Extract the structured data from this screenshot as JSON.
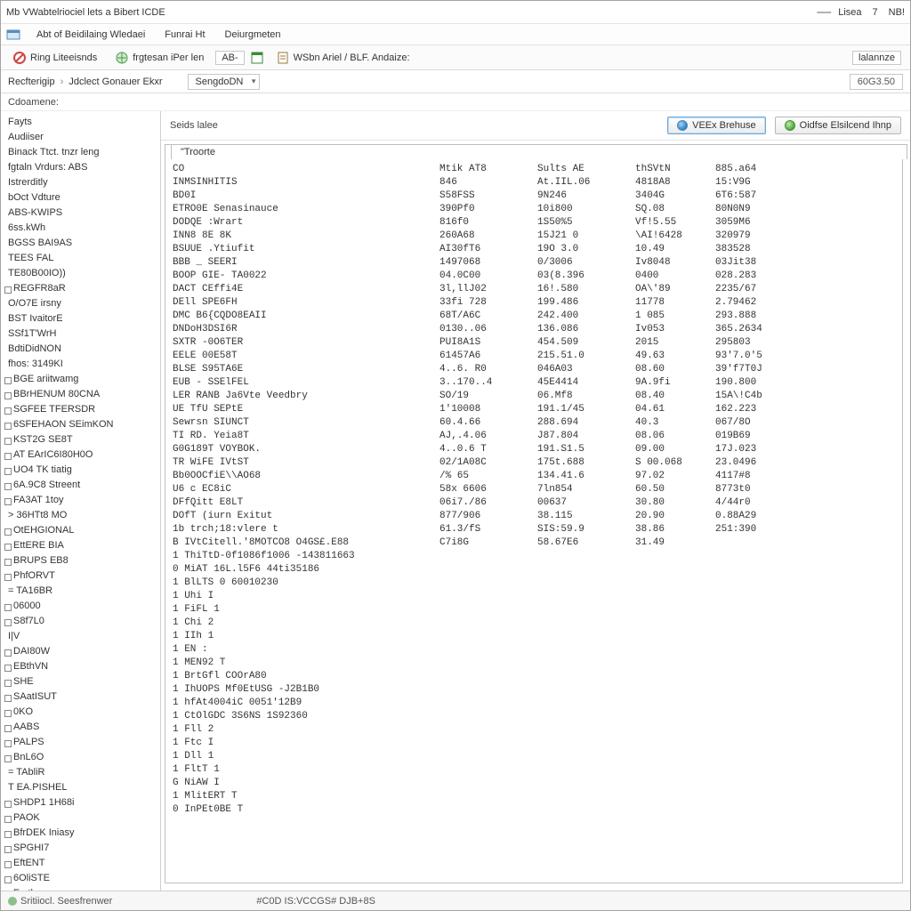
{
  "window": {
    "title": "Mb VWabtelriociel lets a Bibert ICDE",
    "user_label": "Lisea",
    "user_num": "7",
    "user_ext": "NB!"
  },
  "menubar": {
    "item1": "Abt of Beidilaing Wledaei",
    "item2": "Funrai Ht",
    "item3": "Deiurgmeten"
  },
  "toolbar": {
    "btn1": "Ring Liteeisnds",
    "btn2": "frgtesan iPer len",
    "chip": "AB-",
    "btn3": "WSbn Ariel / BLF. Andaize:",
    "right_btn": "lalannze"
  },
  "subbar": {
    "crumb1": "Recfterigip",
    "crumb2": "Jdclect Gonauer Ekxr",
    "dropdown": "SengdoDN",
    "right_num": "60G3.50"
  },
  "labelrow": {
    "text": "Cdoamene:"
  },
  "sidebar": {
    "items": [
      {
        "l": 0,
        "t": "Fayts"
      },
      {
        "l": 0,
        "t": "Audiiser"
      },
      {
        "l": 0,
        "t": "Binack Ttct. tnzr leng"
      },
      {
        "l": 0,
        "t": "fgtaln Vrdurs:   ABS"
      },
      {
        "l": 0,
        "t": " Istrerditly"
      },
      {
        "l": 0,
        "t": "bOct Vdture"
      },
      {
        "l": 0,
        "t": "ABS-KWIPS"
      },
      {
        "l": 0,
        "t": "6ss.kWh"
      },
      {
        "l": 0,
        "t": "BGSS BAI9AS"
      },
      {
        "l": 0,
        "t": "TEES FAL"
      },
      {
        "l": 0,
        "t": "TE80B00IO))"
      },
      {
        "l": 1,
        "t": "REGFR8aR"
      },
      {
        "l": 0,
        "t": "O/O7E irsny"
      },
      {
        "l": 0,
        "t": "BST  IvaitorE"
      },
      {
        "l": 0,
        "t": "SSf1T'WrH"
      },
      {
        "l": 0,
        "t": "BdtiDidNON"
      },
      {
        "l": 0,
        "t": "fhos: 3149KI"
      },
      {
        "l": 1,
        "t": "BGE ariitwamg"
      },
      {
        "l": 1,
        "t": "BBrHENUM 80CNA"
      },
      {
        "l": 1,
        "t": "SGFEE TFERSDR"
      },
      {
        "l": 1,
        "t": "6SFEHAON SEimKON"
      },
      {
        "l": 1,
        "t": "KST2G SE8T"
      },
      {
        "l": 1,
        "t": "AT EArIC6I80H0O"
      },
      {
        "l": 1,
        "t": "UO4 TK tiatig"
      },
      {
        "l": 1,
        "t": "6A.9C8 Streent"
      },
      {
        "l": 1,
        "t": "FA3AT  1toy"
      },
      {
        "l": 0,
        "t": "> 36HTt8 MO"
      },
      {
        "l": 1,
        "t": "OtEHGIONAL"
      },
      {
        "l": 1,
        "t": "EttERE BIA"
      },
      {
        "l": 1,
        "t": "BRUPS EB8"
      },
      {
        "l": 1,
        "t": "PhfORVT"
      },
      {
        "l": 0,
        "t": "= TA16BR"
      },
      {
        "l": 1,
        "t": "06000"
      },
      {
        "l": 1,
        "t": "S8f7L0"
      },
      {
        "l": 0,
        "t": "   I|V"
      },
      {
        "l": 1,
        "t": "DAI80W"
      },
      {
        "l": 1,
        "t": "EBthVN"
      },
      {
        "l": 1,
        "t": "SHE"
      },
      {
        "l": 1,
        "t": "SAatISUT"
      },
      {
        "l": 1,
        "t": "0KO"
      },
      {
        "l": 1,
        "t": "AABS"
      },
      {
        "l": 1,
        "t": "PALPS"
      },
      {
        "l": 1,
        "t": "BnL6O"
      },
      {
        "l": 0,
        "t": "= TAbliR"
      },
      {
        "l": 0,
        "t": "T EA.PISHEL"
      },
      {
        "l": 1,
        "t": "SHDP1 1H68i"
      },
      {
        "l": 1,
        "t": "PAOK"
      },
      {
        "l": 1,
        "t": "BfrDEK Iniasy"
      },
      {
        "l": 1,
        "t": "SPGHI7"
      },
      {
        "l": 1,
        "t": "EftENT"
      },
      {
        "l": 1,
        "t": "6OliSTE"
      },
      {
        "l": 1,
        "t": "Fortlry"
      }
    ]
  },
  "main": {
    "sub_label": "Seids lalee",
    "btn_exec": "VEEx Brehuse",
    "btn_desc": "Oidfse Elsilcend Ihnp",
    "tab": "\"Troorte",
    "header": [
      "CO",
      "Mtik AT8",
      "Sults AE",
      "thSVtN",
      "885.a64"
    ],
    "subheader": [
      "INMSINHITIS",
      "846",
      "At.IIL.06",
      "4818A8",
      "15:V9G"
    ],
    "rows": [
      {
        "c1": "BD0I",
        "c2": "S58FSS",
        "c3": "9N246",
        "c4": "3404G",
        "c5": "6T6:587"
      },
      {
        "c1": "ETRO0E Senasinauce",
        "c2": "390Pf0",
        "c3": "10i800",
        "c4": "SQ.08",
        "c5": "80N0N9"
      },
      {
        "c1": "DODQE :Wrart",
        "c2": "816f0",
        "c3": "1S50%5",
        "c4": "Vf!5.55",
        "c5": "3059M6"
      },
      {
        "c1": "INN8  8E 8K",
        "c2": "260A68",
        "c3": "15J21 0",
        "c4": "\\AI!6428",
        "c5": "320979"
      },
      {
        "c1": "BSUUE .Ytiufit",
        "c2": "AI30fT6",
        "c3": "19O 3.0",
        "c4": "10.49",
        "c5": "383528"
      },
      {
        "c1": "BBB _ SEERI",
        "c2": "1497068",
        "c3": "0/3006",
        "c4": "Iv8048",
        "c5": "03Jit38"
      },
      {
        "c1": "BOOP GIE- TA0022",
        "c2": "04.0C00",
        "c3": "03(8.396",
        "c4": "0400",
        "c5": "028.283"
      },
      {
        "c1": "DACT CEffi4E",
        "c2": "3l,llJ02",
        "c3": "16!.580",
        "c4": "OA\\'89",
        "c5": "2235/67"
      },
      {
        "c1": "DEll  SPE6FH",
        "c2": "33fi 728",
        "c3": "199.486",
        "c4": "11778",
        "c5": "2.79462"
      },
      {
        "c1": "DMC B6{CQDO8EAII",
        "c2": "68T/A6C",
        "c3": "242.400",
        "c4": "1 085",
        "c5": "293.888"
      },
      {
        "c1": "DNDoH3DSI6R",
        "c2": "0130..06",
        "c3": "136.086",
        "c4": "Iv053",
        "c5": "365.2634"
      },
      {
        "c1": "SXTR -0O6TER",
        "c2": "PUI8A1S",
        "c3": "454.509",
        "c4": "2015",
        "c5": "295803"
      },
      {
        "c1": "EELE  00E58T",
        "c2": "61457A6",
        "c3": "215.51.0",
        "c4": "49.63",
        "c5": "93'7.0'5"
      },
      {
        "c1": "BLSE S95TA6E",
        "c2": "4..6. R0",
        "c3": "046A03",
        "c4": "08.60",
        "c5": "39'f7T0J"
      },
      {
        "c1": "EUB - SSElFEL",
        "c2": "3..170..4",
        "c3": "45E4414",
        "c4": "9A.9fi",
        "c5": "190.800"
      },
      {
        "c1": "LER RANB  Ja6Vte  Veedbry",
        "c2": "SO/19",
        "c3": "06.Mf8",
        "c4": "08.40",
        "c5": "15A\\!C4b"
      },
      {
        "c1": "UE TfU SEPtE",
        "c2": "1'10008",
        "c3": "191.1/45",
        "c4": "04.61",
        "c5": "162.223"
      },
      {
        "c1": "Sewrsn SIUNCT",
        "c2": "60.4.66",
        "c3": "288.694",
        "c4": "40.3",
        "c5": "067/8O"
      },
      {
        "c1": "TI  RD. Yeia8T",
        "c2": "AJ,.4.06",
        "c3": "J87.804",
        "c4": "08.06",
        "c5": "019B69"
      },
      {
        "c1": "G0G189T VOYBOK.",
        "c2": "4..0.6 T",
        "c3": "191.S1.5",
        "c4": "09.00",
        "c5": "17J.023"
      },
      {
        "c1": "TR  WiFE IVtST",
        "c2": "02/1A08C",
        "c3": "175t.688",
        "c4": "S 00.068",
        "c5": "23.0496"
      },
      {
        "c1": "Bb0OOCfiE\\\\AO68",
        "c2": "/% 65",
        "c3": "134.41.6",
        "c4": "97.02",
        "c5": "4117#8"
      },
      {
        "c1": "U6  c EC8iC",
        "c2": "58x 6606",
        "c3": "7ln854",
        "c4": "60.50",
        "c5": "8773t0"
      },
      {
        "c1": "DFfQitt   E8LT",
        "c2": "06i7./86",
        "c3": "00637",
        "c4": "30.80",
        "c5": "4/44r0"
      },
      {
        "c1": "DOfT (iurn Exitut",
        "c2": "877/906",
        "c3": "38.115",
        "c4": "20.90",
        "c5": "0.88A29"
      },
      {
        "c1": "1b trch;18:vlere  t",
        "c2": "61.3/fS",
        "c3": "SIS:59.9",
        "c4": "38.86",
        "c5": "251:390"
      },
      {
        "c1": "B IVtCitell.'8MOTCO8  O4GS£.E88",
        "c2": "C7i8G",
        "c3": "58.67E6",
        "c4": "31.49",
        "c5": ""
      },
      {
        "c1": "1 ThiTtD-0f1086f1006 -143811663",
        "c2": "",
        "c3": "",
        "c4": "",
        "c5": ""
      },
      {
        "c1": "0 MiAT    16L.l5F6   44ti35186",
        "c2": "",
        "c3": "",
        "c4": "",
        "c5": ""
      },
      {
        "c1": "1 BlLTS    0       60010230",
        "c2": "",
        "c3": "",
        "c4": "",
        "c5": ""
      },
      {
        "c1": "1 Uhi        I",
        "c2": "",
        "c3": "",
        "c4": "",
        "c5": ""
      },
      {
        "c1": "1 FiFL       1",
        "c2": "",
        "c3": "",
        "c4": "",
        "c5": ""
      },
      {
        "c1": "1 Chi        2",
        "c2": "",
        "c3": "",
        "c4": "",
        "c5": ""
      },
      {
        "c1": "1 IIh        1",
        "c2": "",
        "c3": "",
        "c4": "",
        "c5": ""
      },
      {
        "c1": "1 EN         :",
        "c2": "",
        "c3": "",
        "c4": "",
        "c5": ""
      },
      {
        "c1": "1 MEN92     T",
        "c2": "",
        "c3": "",
        "c4": "",
        "c5": ""
      },
      {
        "c1": "1 BrtGfl COOrA80",
        "c2": "",
        "c3": "",
        "c4": "",
        "c5": ""
      },
      {
        "c1": "1 IhUOPS    Mf0EtUSG -J2B1B0",
        "c2": "",
        "c3": "",
        "c4": "",
        "c5": ""
      },
      {
        "c1": "1 hfAt4004iC      0051'12B9",
        "c2": "",
        "c3": "",
        "c4": "",
        "c5": ""
      },
      {
        "c1": "1 CtOlGDC   3S6NS   1S92360",
        "c2": "",
        "c3": "",
        "c4": "",
        "c5": ""
      },
      {
        "c1": "1 Fll        2",
        "c2": "",
        "c3": "",
        "c4": "",
        "c5": ""
      },
      {
        "c1": "1 Ftc        I",
        "c2": "",
        "c3": "",
        "c4": "",
        "c5": ""
      },
      {
        "c1": "1 Dll        1",
        "c2": "",
        "c3": "",
        "c4": "",
        "c5": ""
      },
      {
        "c1": "1 FltT       1",
        "c2": "",
        "c3": "",
        "c4": "",
        "c5": ""
      },
      {
        "c1": "G NiAW      I",
        "c2": "",
        "c3": "",
        "c4": "",
        "c5": ""
      },
      {
        "c1": "1 MlitERT   T",
        "c2": "",
        "c3": "",
        "c4": "",
        "c5": ""
      },
      {
        "c1": "0 InPEt0BE  T",
        "c2": "",
        "c3": "",
        "c4": "",
        "c5": ""
      }
    ]
  },
  "statusbar": {
    "seg1": "Sritiiocl. Seesfrenwer",
    "seg2": "#C0D IS:VCCGS#  DJB+8S"
  }
}
